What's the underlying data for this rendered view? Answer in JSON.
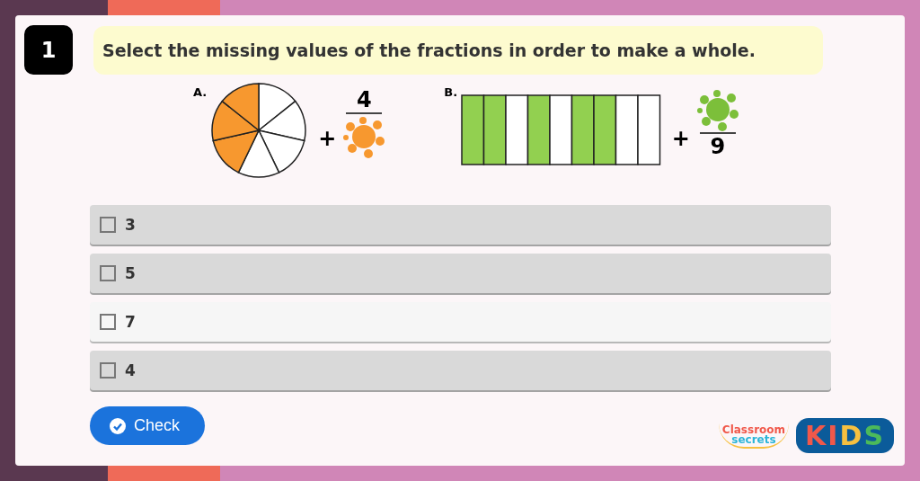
{
  "question": {
    "number": "1",
    "text": "Select the missing values of the fractions in order to make a whole."
  },
  "figures": [
    {
      "label": "A.",
      "kind": "pie",
      "color": "#f7982f",
      "segments": [
        {
          "shaded": false
        },
        {
          "shaded": false
        },
        {
          "shaded": false
        },
        {
          "shaded": false
        },
        {
          "shaded": true
        },
        {
          "shaded": true
        },
        {
          "shaded": true
        }
      ],
      "operator": "+",
      "numerator": "4"
    },
    {
      "label": "B.",
      "kind": "bar",
      "color": "#92d050",
      "segments": [
        {
          "shaded": true
        },
        {
          "shaded": true
        },
        {
          "shaded": false
        },
        {
          "shaded": true
        },
        {
          "shaded": false
        },
        {
          "shaded": true
        },
        {
          "shaded": true
        },
        {
          "shaded": false
        },
        {
          "shaded": false
        }
      ],
      "operator": "+",
      "denominator": "9"
    }
  ],
  "options": [
    {
      "label": "3",
      "checked": false,
      "hovered": false
    },
    {
      "label": "5",
      "checked": false,
      "hovered": false
    },
    {
      "label": "7",
      "checked": false,
      "hovered": true
    },
    {
      "label": "4",
      "checked": false,
      "hovered": false
    }
  ],
  "check_button": "Check",
  "logo": {
    "line_1": "Classroom",
    "line_2": "secrets",
    "badge": "KIDS"
  }
}
